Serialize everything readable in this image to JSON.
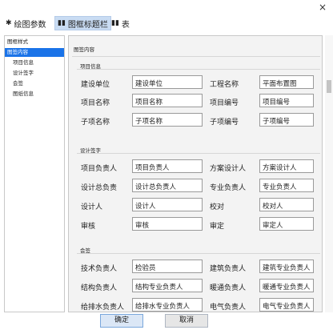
{
  "window": {
    "close_glyph": "×"
  },
  "tabs": [
    {
      "label": "绘图参数",
      "icon": "gear-icon",
      "glyph": "✱"
    },
    {
      "label": "图框标题栏",
      "icon": "book-icon",
      "glyph": "▮▮"
    },
    {
      "label": "表",
      "icon": "table-icon",
      "glyph": "▮▮"
    }
  ],
  "sidebar": {
    "items": [
      {
        "label": "图框样式"
      },
      {
        "label": "图签内容"
      },
      {
        "label": "项目信息"
      },
      {
        "label": "设计签字"
      },
      {
        "label": "会签"
      },
      {
        "label": "图纸信息"
      }
    ]
  },
  "main": {
    "header": "图签内容",
    "sections": {
      "project": {
        "title": "项目信息",
        "fields": [
          {
            "label": "建设单位",
            "value": "建设单位"
          },
          {
            "label": "工程名称",
            "value": "平面布置图"
          },
          {
            "label": "项目名称",
            "value": "项目名称"
          },
          {
            "label": "项目编号",
            "value": "项目编号"
          },
          {
            "label": "子项名称",
            "value": "子项名称"
          },
          {
            "label": "子项编号",
            "value": "子项编号"
          }
        ]
      },
      "sign": {
        "title": "设计签字",
        "fields": [
          {
            "label": "项目负责人",
            "value": "项目负责人"
          },
          {
            "label": "方案设计人",
            "value": "方案设计人"
          },
          {
            "label": "设计总负责",
            "value": "设计总负责人"
          },
          {
            "label": "专业负责人",
            "value": "专业负责人"
          },
          {
            "label": "设计人",
            "value": "设计人"
          },
          {
            "label": "校对",
            "value": "校对人"
          },
          {
            "label": "审核",
            "value": "审核"
          },
          {
            "label": "审定",
            "value": "审定人"
          }
        ]
      },
      "cosign": {
        "title": "会签",
        "fields": [
          {
            "label": "技术负责人",
            "value": "检验员"
          },
          {
            "label": "建筑负责人",
            "value": "建筑专业负责人"
          },
          {
            "label": "结构负责人",
            "value": "结构专业负责人"
          },
          {
            "label": "暖通负责人",
            "value": "暖通专业负责人"
          },
          {
            "label": "给排水负责人",
            "value": "给排水专业负责人"
          },
          {
            "label": "电气负责人",
            "value": "电气专业负责人"
          }
        ]
      }
    }
  },
  "footer": {
    "ok_label": "确定",
    "cancel_label": "取消"
  }
}
